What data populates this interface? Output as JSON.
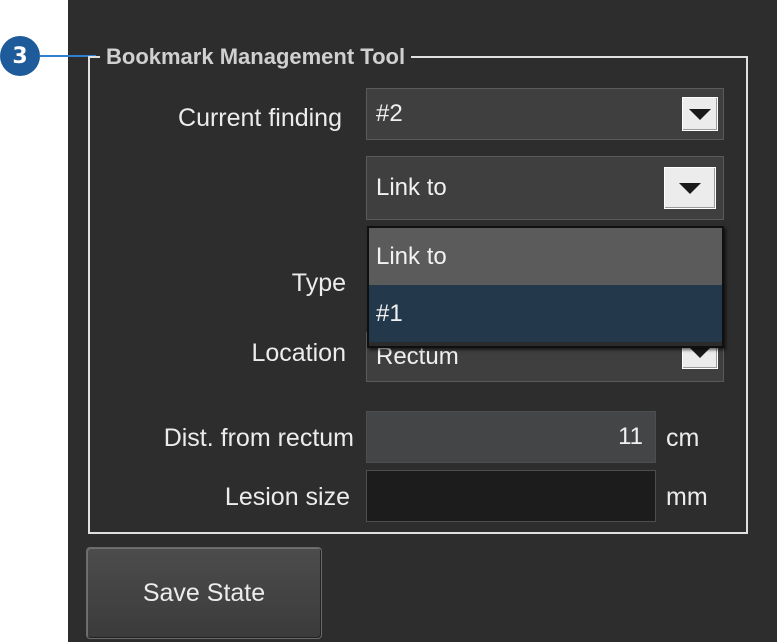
{
  "callout": {
    "number": "3"
  },
  "group": {
    "title": "Bookmark Management Tool"
  },
  "current_finding": {
    "label": "Current finding",
    "value": "#2"
  },
  "link_to": {
    "value": "Link to",
    "options": [
      "Link to",
      "#1"
    ],
    "highlighted": "#1"
  },
  "type": {
    "label": "Type"
  },
  "location": {
    "label": "Location",
    "value": "Rectum"
  },
  "distance": {
    "label": "Dist. from rectum",
    "value": "11",
    "unit": "cm"
  },
  "lesion_size": {
    "label": "Lesion size",
    "value": "",
    "unit": "mm"
  },
  "save_button": {
    "label": "Save State"
  },
  "icons": {
    "dropdown_arrow": "triangle-down",
    "callout": "numbered-circle"
  },
  "colors": {
    "panel_bg": "#2d2d2d",
    "callout_blue": "#1e5b9a",
    "highlight": "#24384c",
    "hover": "#5b5b5b"
  }
}
